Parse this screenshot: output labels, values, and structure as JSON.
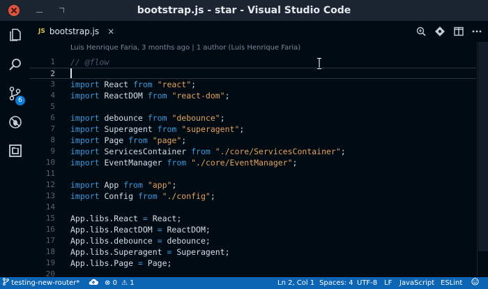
{
  "window": {
    "title": "bootstrap.js - star - Visual Studio Code"
  },
  "activity": {
    "scm_badge": "6"
  },
  "tab": {
    "file_type": "JS",
    "name": "bootstrap.js",
    "close": "×"
  },
  "editor": {
    "codelens": "Luis Henrique Faria, 3 months ago | 1 author (Luis Henrique Faria)",
    "active_line": 2,
    "lines": [
      {
        "n": "1",
        "tokens": [
          {
            "t": "// @flow",
            "c": "cm"
          }
        ]
      },
      {
        "n": "2",
        "tokens": []
      },
      {
        "n": "3",
        "tokens": [
          {
            "t": "import",
            "c": "kw"
          },
          {
            "t": " React "
          },
          {
            "t": "from",
            "c": "kw"
          },
          {
            "t": " "
          },
          {
            "t": "\"react\"",
            "c": "str"
          },
          {
            "t": ";"
          }
        ]
      },
      {
        "n": "4",
        "tokens": [
          {
            "t": "import",
            "c": "kw"
          },
          {
            "t": " ReactDOM "
          },
          {
            "t": "from",
            "c": "kw"
          },
          {
            "t": " "
          },
          {
            "t": "\"react-dom\"",
            "c": "str"
          },
          {
            "t": ";"
          }
        ]
      },
      {
        "n": "5",
        "tokens": []
      },
      {
        "n": "6",
        "tokens": [
          {
            "t": "import",
            "c": "kw"
          },
          {
            "t": " debounce "
          },
          {
            "t": "from",
            "c": "kw"
          },
          {
            "t": " "
          },
          {
            "t": "\"debounce\"",
            "c": "str"
          },
          {
            "t": ";"
          }
        ]
      },
      {
        "n": "7",
        "tokens": [
          {
            "t": "import",
            "c": "kw"
          },
          {
            "t": " Superagent "
          },
          {
            "t": "from",
            "c": "kw"
          },
          {
            "t": " "
          },
          {
            "t": "\"superagent\"",
            "c": "str"
          },
          {
            "t": ";"
          }
        ]
      },
      {
        "n": "8",
        "tokens": [
          {
            "t": "import",
            "c": "kw"
          },
          {
            "t": " Page "
          },
          {
            "t": "from",
            "c": "kw"
          },
          {
            "t": " "
          },
          {
            "t": "\"page\"",
            "c": "str"
          },
          {
            "t": ";"
          }
        ]
      },
      {
        "n": "9",
        "tokens": [
          {
            "t": "import",
            "c": "kw"
          },
          {
            "t": " ServicesContainer "
          },
          {
            "t": "from",
            "c": "kw"
          },
          {
            "t": " "
          },
          {
            "t": "\"./core/ServicesContainer\"",
            "c": "str"
          },
          {
            "t": ";"
          }
        ]
      },
      {
        "n": "10",
        "tokens": [
          {
            "t": "import",
            "c": "kw"
          },
          {
            "t": " EventManager "
          },
          {
            "t": "from",
            "c": "kw"
          },
          {
            "t": " "
          },
          {
            "t": "\"./core/EventManager\"",
            "c": "str"
          },
          {
            "t": ";"
          }
        ]
      },
      {
        "n": "11",
        "tokens": []
      },
      {
        "n": "12",
        "tokens": [
          {
            "t": "import",
            "c": "kw"
          },
          {
            "t": " App "
          },
          {
            "t": "from",
            "c": "kw"
          },
          {
            "t": " "
          },
          {
            "t": "\"app\"",
            "c": "str"
          },
          {
            "t": ";"
          }
        ]
      },
      {
        "n": "13",
        "tokens": [
          {
            "t": "import",
            "c": "kw"
          },
          {
            "t": " Config "
          },
          {
            "t": "from",
            "c": "kw"
          },
          {
            "t": " "
          },
          {
            "t": "\"./config\"",
            "c": "str"
          },
          {
            "t": ";"
          }
        ]
      },
      {
        "n": "14",
        "tokens": []
      },
      {
        "n": "15",
        "tokens": [
          {
            "t": "App.libs.React "
          },
          {
            "t": "=",
            "c": "op"
          },
          {
            "t": " React;"
          }
        ]
      },
      {
        "n": "16",
        "tokens": [
          {
            "t": "App.libs.ReactDOM "
          },
          {
            "t": "=",
            "c": "op"
          },
          {
            "t": " ReactDOM;"
          }
        ]
      },
      {
        "n": "17",
        "tokens": [
          {
            "t": "App.libs.debounce "
          },
          {
            "t": "=",
            "c": "op"
          },
          {
            "t": " debounce;"
          }
        ]
      },
      {
        "n": "18",
        "tokens": [
          {
            "t": "App.libs.Superagent "
          },
          {
            "t": "=",
            "c": "op"
          },
          {
            "t": " Superagent;"
          }
        ]
      },
      {
        "n": "19",
        "tokens": [
          {
            "t": "App.libs.Page "
          },
          {
            "t": "=",
            "c": "op"
          },
          {
            "t": " Page;"
          }
        ]
      },
      {
        "n": "20",
        "tokens": []
      }
    ]
  },
  "status": {
    "branch": "testing-new-router*",
    "errors": "0",
    "warnings": "1",
    "position": "Ln 2, Col 1",
    "spaces": "Spaces: 4",
    "encoding": "UTF-8",
    "eol": "LF",
    "language": "JavaScript",
    "linter": "ESLint"
  }
}
